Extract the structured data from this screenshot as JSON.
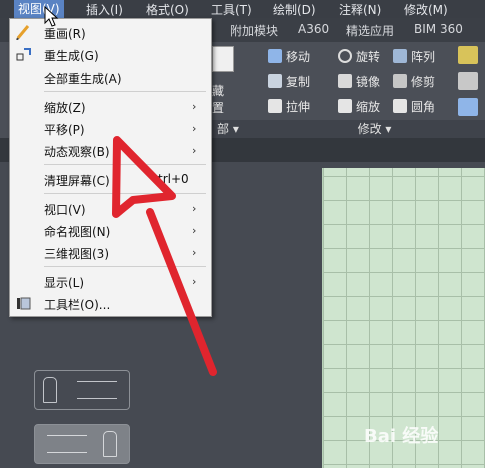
{
  "menubar": {
    "items": [
      "视图(V)",
      "插入(I)",
      "格式(O)",
      "工具(T)",
      "绘制(D)",
      "注释(N)",
      "修改(M)"
    ]
  },
  "ribbon_tabs": [
    "附加模块",
    "A360",
    "精选应用",
    "BIM 360"
  ],
  "ribbon": {
    "row1": [
      "移动",
      "旋转",
      "阵列"
    ],
    "row2": [
      "复制",
      "镜像",
      "修剪"
    ],
    "row3": [
      "拉伸",
      "缩放",
      "圆角"
    ],
    "panel_left": "藏",
    "panel_left2": "置",
    "panel_mid": "部 ▾",
    "panel_modify": "修改 ▾"
  },
  "menu": {
    "redraw": "重画(R)",
    "regen": "重生成(G)",
    "regen_all": "全部重生成(A)",
    "zoom": "缩放(Z)",
    "pan": "平移(P)",
    "orbit": "动态观察(B)",
    "clean_screen": "清理屏幕(C)",
    "clean_shortcut": "trl+0",
    "viewports": "视口(V)",
    "named_views": "命名视图(N)",
    "views_3d": "三维视图(3)",
    "display": "显示(L)",
    "toolbars": "工具栏(O)..."
  },
  "watermark": "Bai 经验",
  "colors": {
    "accent": "#5a83c3",
    "arrow": "#e0252e",
    "grid_bg": "#cfe5cf"
  }
}
